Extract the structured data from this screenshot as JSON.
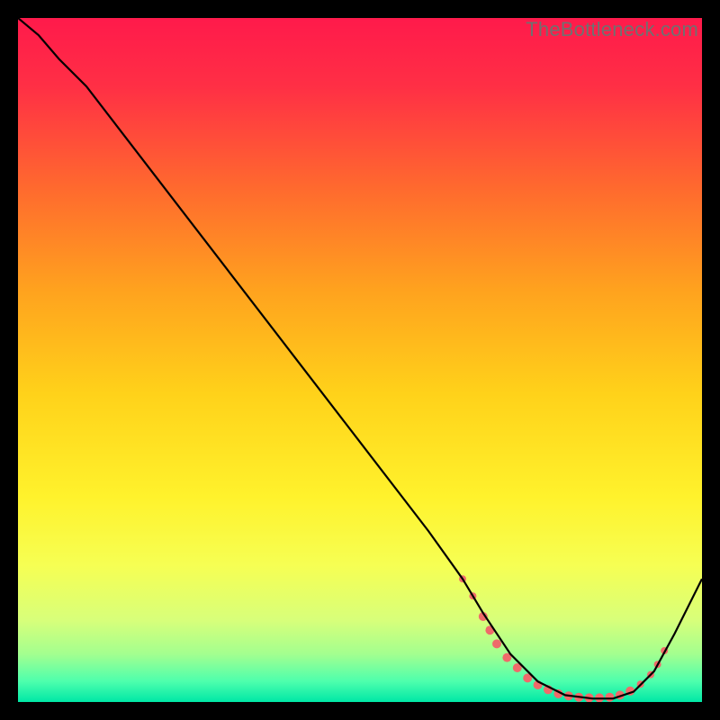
{
  "watermark": "TheBottleneck.com",
  "chart_data": {
    "type": "line",
    "title": "",
    "xlabel": "",
    "ylabel": "",
    "xlim": [
      0,
      100
    ],
    "ylim": [
      0,
      100
    ],
    "background_gradient": {
      "stops": [
        {
          "offset": 0.0,
          "color": "#ff1a4b"
        },
        {
          "offset": 0.1,
          "color": "#ff2f45"
        },
        {
          "offset": 0.25,
          "color": "#ff6a2e"
        },
        {
          "offset": 0.4,
          "color": "#ffa31e"
        },
        {
          "offset": 0.55,
          "color": "#ffd21a"
        },
        {
          "offset": 0.7,
          "color": "#fff22c"
        },
        {
          "offset": 0.8,
          "color": "#f6ff53"
        },
        {
          "offset": 0.88,
          "color": "#d8ff7a"
        },
        {
          "offset": 0.93,
          "color": "#a3ff8f"
        },
        {
          "offset": 0.97,
          "color": "#4dffad"
        },
        {
          "offset": 1.0,
          "color": "#00e7a6"
        }
      ]
    },
    "series": [
      {
        "name": "bottleneck-curve",
        "x": [
          0.0,
          3.0,
          6.0,
          10.0,
          20.0,
          30.0,
          40.0,
          50.0,
          60.0,
          65.0,
          68.0,
          72.0,
          76.0,
          80.0,
          84.0,
          87.0,
          90.0,
          93.0,
          96.0,
          100.0
        ],
        "y": [
          100.0,
          97.5,
          94.0,
          90.0,
          77.0,
          64.0,
          51.0,
          38.0,
          25.0,
          18.0,
          13.0,
          7.0,
          3.0,
          1.0,
          0.5,
          0.5,
          1.5,
          4.5,
          10.0,
          18.0
        ]
      }
    ],
    "marker_cluster": {
      "color": "#ef6a6a",
      "points": [
        {
          "x": 65.0,
          "y": 18.0,
          "r": 4
        },
        {
          "x": 66.5,
          "y": 15.5,
          "r": 4
        },
        {
          "x": 68.0,
          "y": 12.5,
          "r": 5
        },
        {
          "x": 69.0,
          "y": 10.5,
          "r": 5
        },
        {
          "x": 70.0,
          "y": 8.5,
          "r": 5
        },
        {
          "x": 71.5,
          "y": 6.5,
          "r": 5
        },
        {
          "x": 73.0,
          "y": 5.0,
          "r": 5
        },
        {
          "x": 74.5,
          "y": 3.5,
          "r": 5
        },
        {
          "x": 76.0,
          "y": 2.5,
          "r": 5
        },
        {
          "x": 77.5,
          "y": 1.8,
          "r": 5
        },
        {
          "x": 79.0,
          "y": 1.2,
          "r": 5
        },
        {
          "x": 80.5,
          "y": 0.9,
          "r": 5
        },
        {
          "x": 82.0,
          "y": 0.7,
          "r": 5
        },
        {
          "x": 83.5,
          "y": 0.6,
          "r": 5
        },
        {
          "x": 85.0,
          "y": 0.6,
          "r": 5
        },
        {
          "x": 86.5,
          "y": 0.7,
          "r": 5
        },
        {
          "x": 88.0,
          "y": 1.0,
          "r": 5
        },
        {
          "x": 89.5,
          "y": 1.6,
          "r": 5
        },
        {
          "x": 91.0,
          "y": 2.6,
          "r": 4
        },
        {
          "x": 92.5,
          "y": 4.0,
          "r": 4
        },
        {
          "x": 93.5,
          "y": 5.5,
          "r": 4
        },
        {
          "x": 94.5,
          "y": 7.5,
          "r": 4
        }
      ]
    }
  }
}
